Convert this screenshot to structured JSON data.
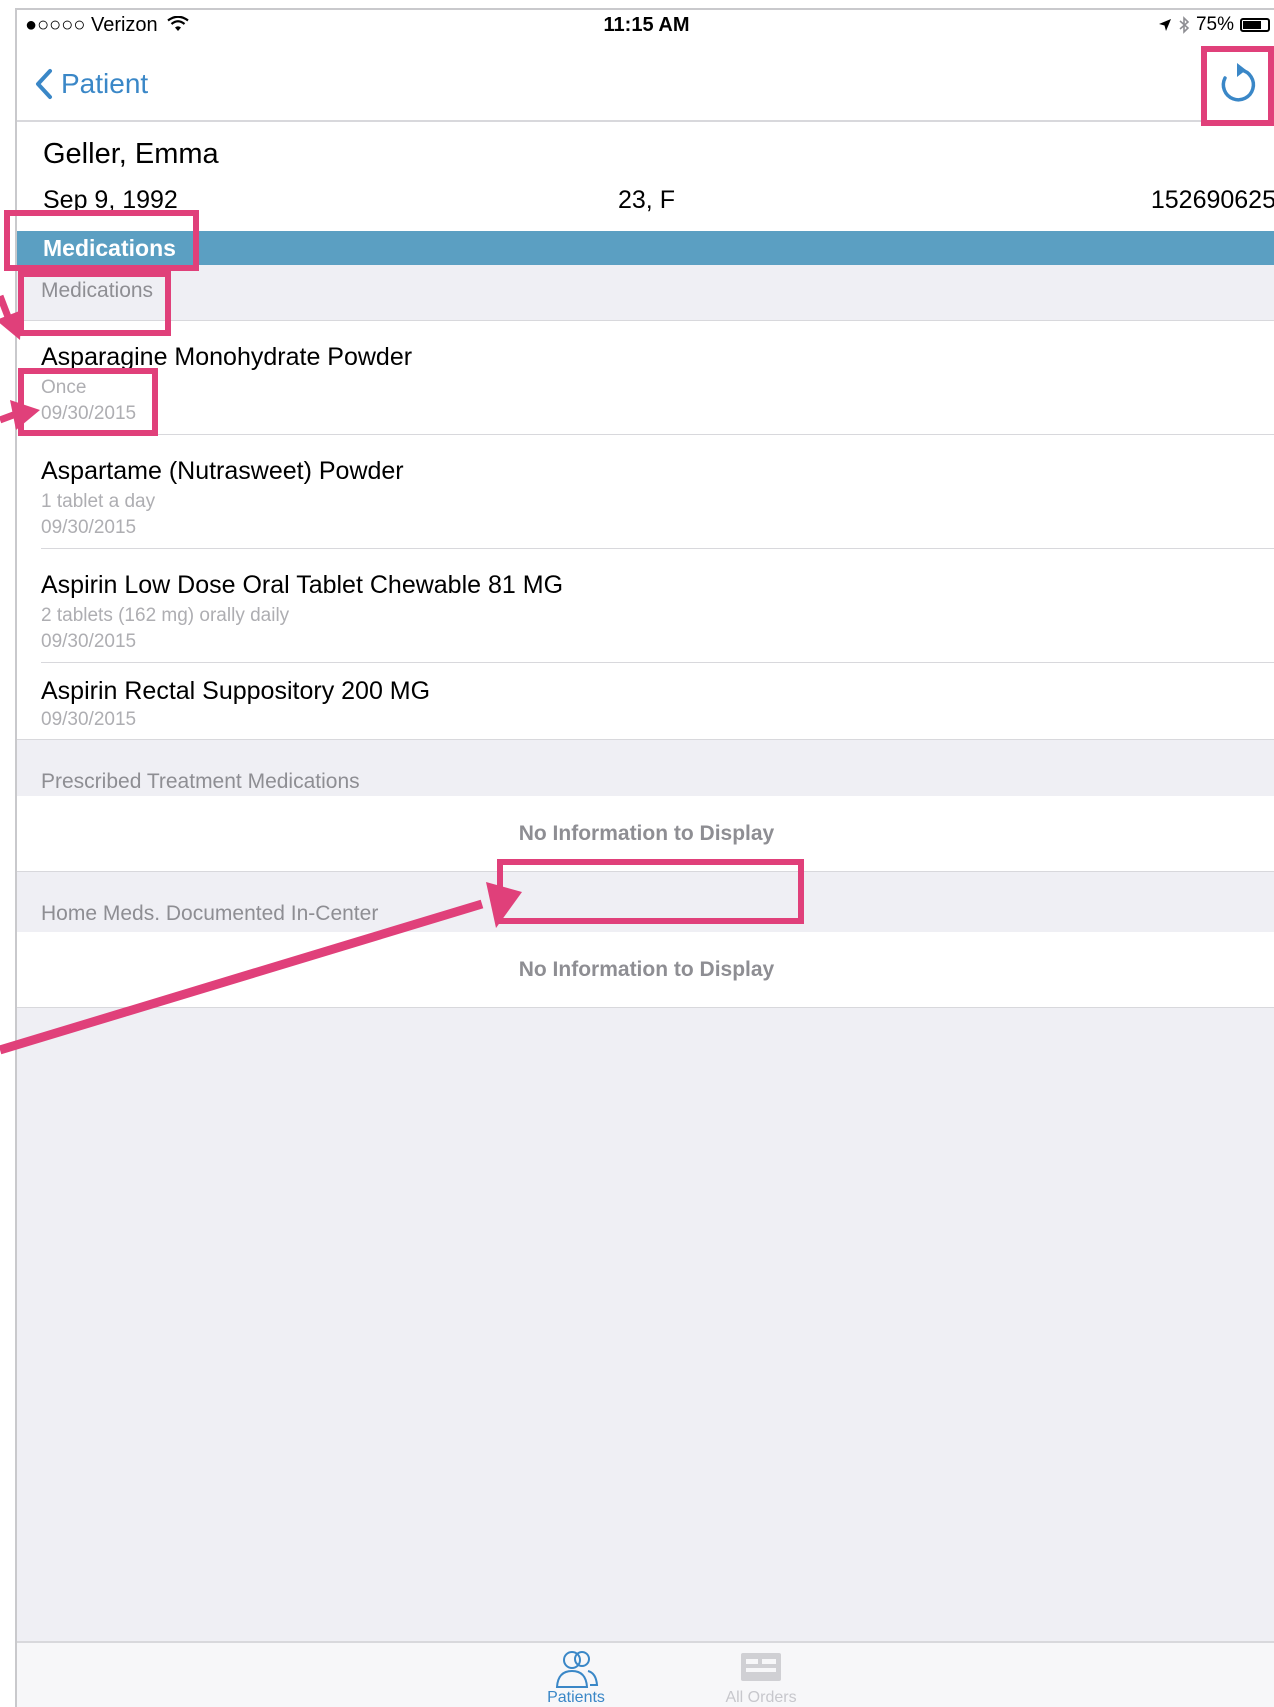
{
  "status_bar": {
    "carrier": "●○○○○ Verizon",
    "time": "11:15 AM",
    "battery_percent": "75%",
    "battery_level": 0.75
  },
  "nav": {
    "back_label": "Patient",
    "back_icon": "chevron-left-icon",
    "refresh_icon": "refresh-icon"
  },
  "patient": {
    "name": "Geller, Emma",
    "dob": "Sep 9, 1992",
    "age_sex": "23, F",
    "mrn": "152690625"
  },
  "section": {
    "title": "Medications"
  },
  "groups": {
    "medications": {
      "header": "Medications",
      "items": [
        {
          "name": "Asparagine Monohydrate Powder",
          "frequency": "Once",
          "date": "09/30/2015"
        },
        {
          "name": "Aspartame (Nutrasweet) Powder",
          "frequency": "1 tablet a day",
          "date": "09/30/2015"
        },
        {
          "name": "Aspirin Low Dose Oral Tablet Chewable 81 MG",
          "frequency": "2 tablets (162 mg) orally daily",
          "date": "09/30/2015"
        },
        {
          "name": "Aspirin Rectal Suppository 200 MG",
          "date": "09/30/2015"
        }
      ]
    },
    "prescribed": {
      "header": "Prescribed Treatment Medications",
      "empty_text": "No Information to Display"
    },
    "home_meds": {
      "header": "Home Meds. Documented In-Center",
      "empty_text": "No Information to Display"
    }
  },
  "tab_bar": {
    "tabs": [
      {
        "label": "Patients",
        "icon": "patients-icon",
        "active": true
      },
      {
        "label": "All Orders",
        "icon": "all-orders-icon",
        "active": false
      }
    ]
  },
  "colors": {
    "accent": "#3a87c7",
    "section_bar": "#5b9fc2",
    "annotation": "#e0407a",
    "secondary_text": "#8e8e93"
  }
}
